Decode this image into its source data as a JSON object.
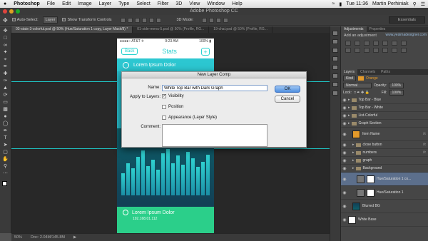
{
  "menubar": {
    "apple": "",
    "app_name": "Photoshop",
    "items": [
      "File",
      "Edit",
      "Image",
      "Layer",
      "Type",
      "Select",
      "Filter",
      "3D",
      "View",
      "Window",
      "Help"
    ],
    "clock": "Tue 11:36",
    "user": "Martin Perhiniak"
  },
  "window": {
    "title": "Adobe Photoshop CC"
  },
  "options": {
    "auto_select": "Auto-Select:",
    "layer_select": "Layer",
    "transform_controls": "Show Transform Controls",
    "mode_3d": "3D Mode:",
    "workspace": "Essentials"
  },
  "doc_tabs": [
    {
      "label": "03-stats-3-colorful.psd @ 50% (Hue/Saturation 1 copy, Layer Mask/8) *",
      "active": true
    },
    {
      "label": "01-side-menu-5.psd @ 50% (Profile, RG...",
      "active": false
    },
    {
      "label": "19-chat.psd @ 50% (Profile, RG...",
      "active": false
    }
  ],
  "tools": [
    "move",
    "marquee",
    "lasso",
    "quick-select",
    "crop",
    "eyedropper",
    "healing",
    "brush",
    "stamp",
    "history",
    "eraser",
    "gradient",
    "blur",
    "dodge",
    "pen",
    "type",
    "path-select",
    "shape",
    "hand",
    "zoom",
    "more"
  ],
  "phone": {
    "carrier": "●●●●○ AT&T ✈",
    "time": "9:23 AM",
    "battery": "100% ▮",
    "back_label": "Back",
    "title": "Stats",
    "plus": "+",
    "row1": "Lorem Ipsum Dolor",
    "bottom_title": "Lorem Ipsum Dolor",
    "bottom_sub": "192.168.01.112"
  },
  "graph_values": [
    0.35,
    0.5,
    0.42,
    0.6,
    0.7,
    0.45,
    0.55,
    0.4,
    0.65,
    0.72,
    0.5,
    0.62,
    0.48,
    0.68,
    0.58,
    0.44,
    0.52,
    0.63
  ],
  "dialog": {
    "title": "New Layer Comp",
    "name_label": "Name:",
    "name_value": "White Top Bar with Dark Graph",
    "apply_label": "Apply to Layers:",
    "visibility": "Visibility",
    "position": "Position",
    "appearance": "Appearance (Layer Style)",
    "comment_label": "Comment:",
    "ok": "OK",
    "cancel": "Cancel"
  },
  "status": {
    "zoom": "50%",
    "doc": "Doc: 2.04M/145.8M"
  },
  "adjustments": {
    "tabs": [
      "Adjustments",
      "Properties"
    ],
    "url": "www.yesimadesigner.com",
    "add_label": "Add an adjustment"
  },
  "layers_panel": {
    "tabs": [
      "Layers",
      "Channels",
      "Paths"
    ],
    "kind": "Kind",
    "blend": "Normal",
    "opacity_label": "Opacity:",
    "opacity": "100%",
    "lock_label": "Lock:",
    "fill_label": "Fill:",
    "fill": "100%",
    "layers": [
      {
        "name": "Top Bar - Blue",
        "type": "group"
      },
      {
        "name": "Top Bar - White",
        "type": "group"
      },
      {
        "name": "List-Colorful",
        "type": "group"
      },
      {
        "name": "Graph Section",
        "type": "group"
      },
      {
        "name": "Item Name",
        "type": "text",
        "fx": "fx"
      },
      {
        "name": "close button",
        "type": "group",
        "fx": "fx"
      },
      {
        "name": "numbers",
        "type": "group",
        "fx": "fx"
      },
      {
        "name": "graph",
        "type": "group"
      },
      {
        "name": "Background",
        "type": "group"
      },
      {
        "name": "Hue/Saturation 1 co...",
        "type": "adj",
        "selected": true
      },
      {
        "name": "Hue/Saturation 1",
        "type": "adj"
      },
      {
        "name": "Blurred BG",
        "type": "image"
      },
      {
        "name": "White Base",
        "type": "image"
      }
    ]
  }
}
